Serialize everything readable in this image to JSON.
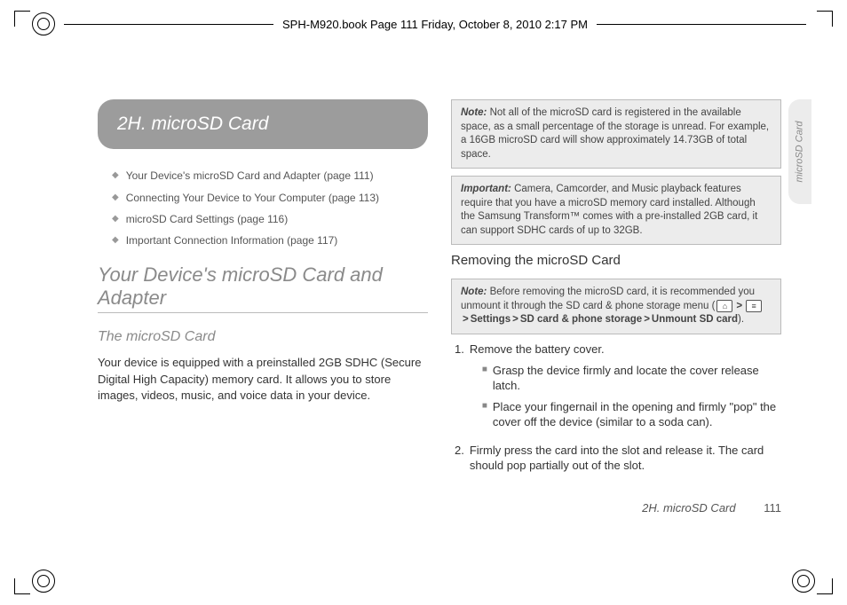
{
  "pasteboard": {
    "header": "SPH-M920.book  Page 111  Friday, October 8, 2010  2:17 PM"
  },
  "sidetab": {
    "label": "microSD Card"
  },
  "chapter": {
    "title": "2H.  microSD Card"
  },
  "toc": {
    "items": [
      "Your Device's microSD Card and Adapter (page 111)",
      "Connecting Your Device to Your Computer (page 113)",
      "microSD Card Settings (page 116)",
      "Important Connection Information (page 117)"
    ]
  },
  "section1": {
    "title": "Your Device's microSD Card and Adapter",
    "subtitle": "The microSD Card",
    "body": "Your device is equipped with a preinstalled 2GB SDHC (Secure Digital High Capacity) memory card. It allows you to store images, videos, music, and voice data in your device."
  },
  "note1": {
    "label": "Note:",
    "text": "Not all of the microSD card is registered in the available space, as a small percentage of the storage is unread. For example, a 16GB microSD card will show approximately 14.73GB of total space."
  },
  "important1": {
    "label": "Important:",
    "text": "Camera, Camcorder, and Music playback features require that you have a microSD memory card installed. Although the Samsung Transform™ comes with a pre-installed 2GB card, it can support SDHC cards of up to 32GB."
  },
  "section2": {
    "title": "Removing the microSD Card"
  },
  "note2": {
    "label": "Note:",
    "lead": "Before removing the microSD card, it is recommended you unmount it through the SD card & phone storage menu (",
    "home_icon": "⌂",
    "menu_icon": "≡",
    "p1": "Settings",
    "p2": "SD card & phone storage",
    "p3": "Unmount SD card",
    "tail": ")."
  },
  "steps": {
    "s1": {
      "n": "1.",
      "t": "Remove the battery cover."
    },
    "s1a": "Grasp the device firmly and locate the cover release latch.",
    "s1b": "Place your fingernail in the opening and firmly \"pop\" the cover off the device (similar to a soda can).",
    "s2": {
      "n": "2.",
      "t": "Firmly press the card into the slot and release it. The card should pop partially out of the slot."
    }
  },
  "footer": {
    "section": "2H. microSD Card",
    "page": "111"
  }
}
